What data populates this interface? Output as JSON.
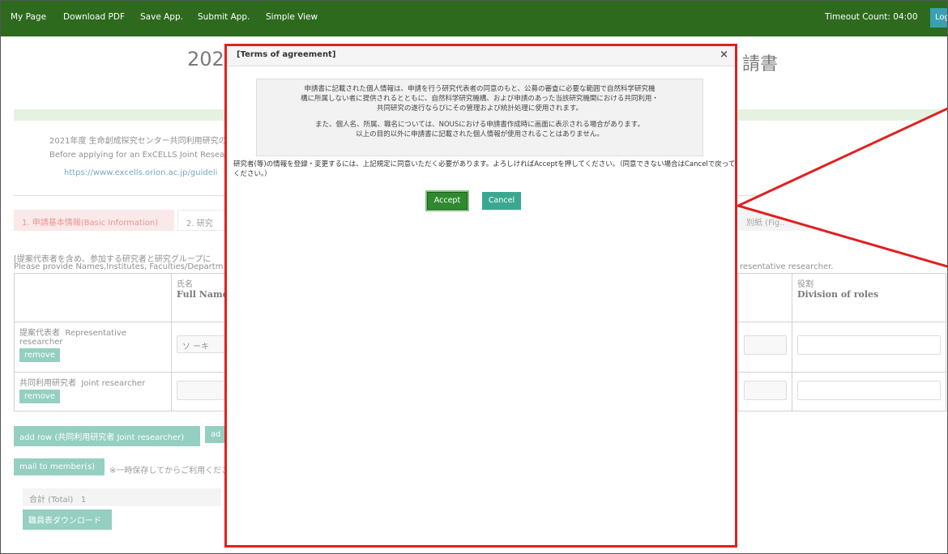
{
  "nav": {
    "items": [
      "My Page",
      "Download PDF",
      "Save App.",
      "Submit App.",
      "Simple View"
    ],
    "timeout": "Timeout Count: 04:00",
    "logout": "Log"
  },
  "page": {
    "title_partial": "202",
    "title_right": "請書",
    "intro_line1": "2021年度 生命創成探究センター共同利用研究の",
    "intro_line2": "Before applying for an ExCELLS Joint Resea",
    "intro_link": "https://www.excells.orion.ac.jp/guideli",
    "tab_active": "1. 申請基本情報(Basic Information)",
    "tab_next": "2. 研究",
    "tab_right": "別紙 (Fig..",
    "note_jp": "[提案代表者を含め、参加する研究者と研究グループに",
    "note_en": "Please provide Names,Institutes, Faculties/Departm",
    "note_en_right": "resentative researcher.",
    "col_name_jp": "氏名",
    "col_name_en": "Full Name",
    "col_roles_jp": "役割",
    "col_roles_en": "Division of roles",
    "row1_label_jp": "提案代表者",
    "row1_label_en": "Representative researcher",
    "row1_name_value": "ソ ーキ",
    "row2_label_jp": "共同利用研究者",
    "row2_label_en": "Joint researcher",
    "remove_label": "remove",
    "add_row": "add row (共同利用研究者 Joint researcher)",
    "add_row2": "ad",
    "mail_btn": "mail to member(s)",
    "mail_note": "※一時保存してからご利用くださ",
    "total_label": "合計 (Total)",
    "total_value": "1",
    "download_btn": "職員表ダウンロード"
  },
  "modal": {
    "title": "[Terms of agreement]",
    "close": "×",
    "terms_line1": "申請書に記載された個人情報は、申請を行う研究代表者の同意のもと、公募の審査に必要な範囲で自然科学研究機",
    "terms_line2": "構に所属しない者に提供されるとともに、自然科学研究機構、および申請のあった当該研究機関における共同利用・",
    "terms_line3": "共同研究の遂行ならびにその管理および統計処理に使用されます。",
    "terms_line4": "また、個人名、所属、職名については、NOUSにおける申請書作成時に画面に表示される場合があります。",
    "terms_line5": "以上の目的以外に申請書に記載された個人情報が使用されることはありません。",
    "confirm_text": "研究者(等)の情報を登録・変更するには、上記規定に同意いただく必要があります。よろしければAcceptを押してください。（同意できない場合はCancelで戻ってください。）",
    "accept": "Accept",
    "cancel": "Cancel"
  },
  "colors": {
    "nav_bg": "#2d6a1e",
    "highlight": "#e02020",
    "accept_bg": "#2f8a2f",
    "cancel_bg": "#3aa890",
    "teal": "#5bb5a0"
  }
}
